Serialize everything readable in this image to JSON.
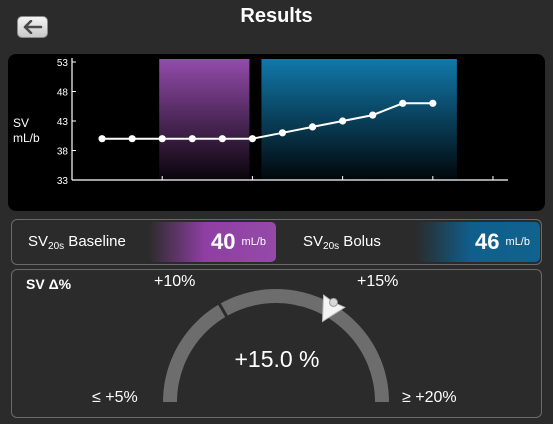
{
  "header": {
    "title": "Results",
    "back_icon": "arrow-left-icon"
  },
  "chart_data": {
    "type": "line",
    "ylabel": "SV\nmL/b",
    "ylabel_line1": "SV",
    "ylabel_line2": "mL/b",
    "yticks": [
      "53",
      "48",
      "43",
      "38",
      "33"
    ],
    "ylim": [
      33,
      53
    ],
    "grid": false,
    "x": [
      1,
      2,
      3,
      4,
      5,
      6,
      7,
      8,
      9,
      10,
      11,
      12
    ],
    "series": [
      {
        "values": [
          40,
          40,
          40,
          40,
          40,
          40,
          41,
          42,
          43,
          44,
          46,
          46
        ]
      }
    ],
    "highlight_regions": [
      {
        "role": "baseline",
        "x_from": 2.9,
        "x_to": 5.9,
        "color": "#9b4fb4"
      },
      {
        "role": "bolus",
        "x_from": 6.3,
        "x_to": 12.8,
        "color": "#127fb4"
      }
    ]
  },
  "summary": {
    "baseline_label": "SV",
    "baseline_sub": "20s",
    "baseline_suffix": " Baseline",
    "baseline_value": "40",
    "baseline_unit": "mL/b",
    "bolus_label": "SV",
    "bolus_sub": "20s",
    "bolus_suffix": " Bolus",
    "bolus_value": "46",
    "bolus_unit": "mL/b"
  },
  "gauge": {
    "title": "SV Δ%",
    "value_text": "+15.0 %",
    "value": 15.0,
    "min_label": "≤ +5%",
    "max_label": "≥ +20%",
    "mark_10_label": "+10%",
    "mark_15_label": "+15%",
    "scale_min": 5,
    "scale_max": 20,
    "threshold": 10
  },
  "colors": {
    "background": "#2b2b2b",
    "baseline": "#9b4fb4",
    "bolus": "#127fb4",
    "gauge_track": "#6d6d6d"
  }
}
